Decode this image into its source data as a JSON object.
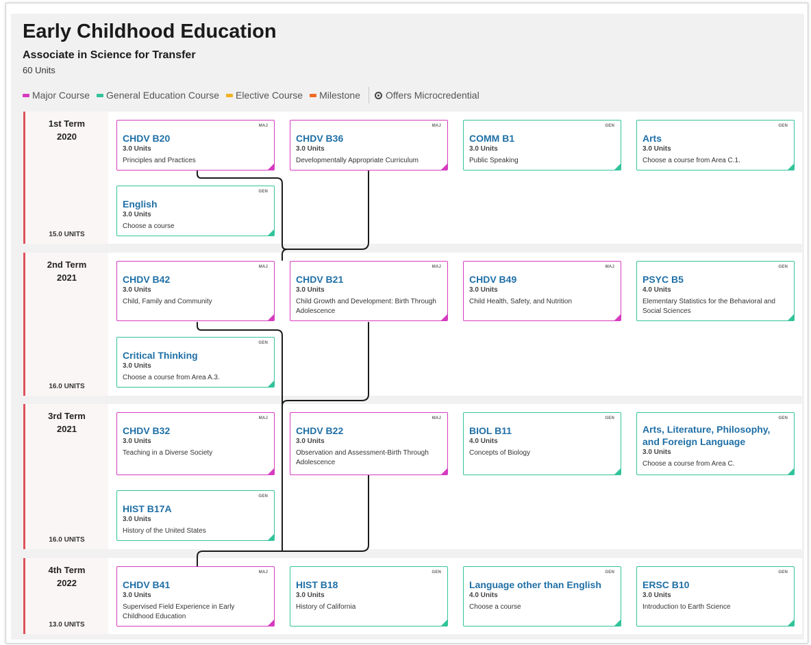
{
  "program": {
    "title": "Early Childhood Education",
    "subtitle": "Associate in Science for Transfer",
    "units": "60 Units"
  },
  "legend": {
    "items": [
      {
        "label": "Major Course",
        "color": "#d63bbf"
      },
      {
        "label": "General Education Course",
        "color": "#33c39a"
      },
      {
        "label": "Elective Course",
        "color": "#f0b323"
      },
      {
        "label": "Milestone",
        "color": "#ef6a25"
      }
    ],
    "microcredential": "Offers Microcredential"
  },
  "terms": [
    {
      "name": "1st Term",
      "year": "2020",
      "units": "15.0 UNITS",
      "courses": [
        {
          "type": "MAJ",
          "code": "CHDV B20",
          "units": "3.0 Units",
          "desc": "Principles and Practices"
        },
        {
          "type": "MAJ",
          "code": "CHDV B36",
          "units": "3.0 Units",
          "desc": "Developmentally Appropriate Curriculum"
        },
        {
          "type": "GEN",
          "code": "COMM B1",
          "units": "3.0 Units",
          "desc": "Public Speaking"
        },
        {
          "type": "GEN",
          "code": "Arts",
          "units": "3.0 Units",
          "desc": "Choose a course from Area C.1."
        },
        {
          "type": "GEN",
          "code": "English",
          "units": "3.0 Units",
          "desc": "Choose a course"
        }
      ]
    },
    {
      "name": "2nd Term",
      "year": "2021",
      "units": "16.0 UNITS",
      "courses": [
        {
          "type": "MAJ",
          "code": "CHDV B42",
          "units": "3.0 Units",
          "desc": "Child, Family and Community"
        },
        {
          "type": "MAJ",
          "code": "CHDV B21",
          "units": "3.0 Units",
          "desc": "Child Growth and Development: Birth Through Adolescence"
        },
        {
          "type": "MAJ",
          "code": "CHDV B49",
          "units": "3.0 Units",
          "desc": "Child Health, Safety, and Nutrition"
        },
        {
          "type": "GEN",
          "code": "PSYC B5",
          "units": "4.0 Units",
          "desc": "Elementary Statistics for the Behavioral and Social Sciences"
        },
        {
          "type": "GEN",
          "code": "Critical Thinking",
          "units": "3.0 Units",
          "desc": "Choose a course from Area A.3."
        }
      ]
    },
    {
      "name": "3rd Term",
      "year": "2021",
      "units": "16.0 UNITS",
      "courses": [
        {
          "type": "MAJ",
          "code": "CHDV B32",
          "units": "3.0 Units",
          "desc": "Teaching in a Diverse Society"
        },
        {
          "type": "MAJ",
          "code": "CHDV B22",
          "units": "3.0 Units",
          "desc": "Observation and Assessment-Birth Through Adolescence"
        },
        {
          "type": "GEN",
          "code": "BIOL B11",
          "units": "4.0 Units",
          "desc": "Concepts of Biology"
        },
        {
          "type": "GEN",
          "code": "Arts, Literature, Philosophy, and Foreign Language",
          "units": "3.0 Units",
          "desc": "Choose a course from Area C."
        },
        {
          "type": "GEN",
          "code": "HIST B17A",
          "units": "3.0 Units",
          "desc": "History of the United States"
        }
      ]
    },
    {
      "name": "4th Term",
      "year": "2022",
      "units": "13.0 UNITS",
      "courses": [
        {
          "type": "MAJ",
          "code": "CHDV B41",
          "units": "3.0 Units",
          "desc": "Supervised Field Experience in Early Childhood Education"
        },
        {
          "type": "GEN",
          "code": "HIST B18",
          "units": "3.0 Units",
          "desc": "History of California"
        },
        {
          "type": "GEN",
          "code": "Language other than English",
          "units": "4.0 Units",
          "desc": "Choose a course"
        },
        {
          "type": "GEN",
          "code": "ERSC B10",
          "units": "3.0 Units",
          "desc": "Introduction to Earth Science"
        }
      ]
    }
  ]
}
